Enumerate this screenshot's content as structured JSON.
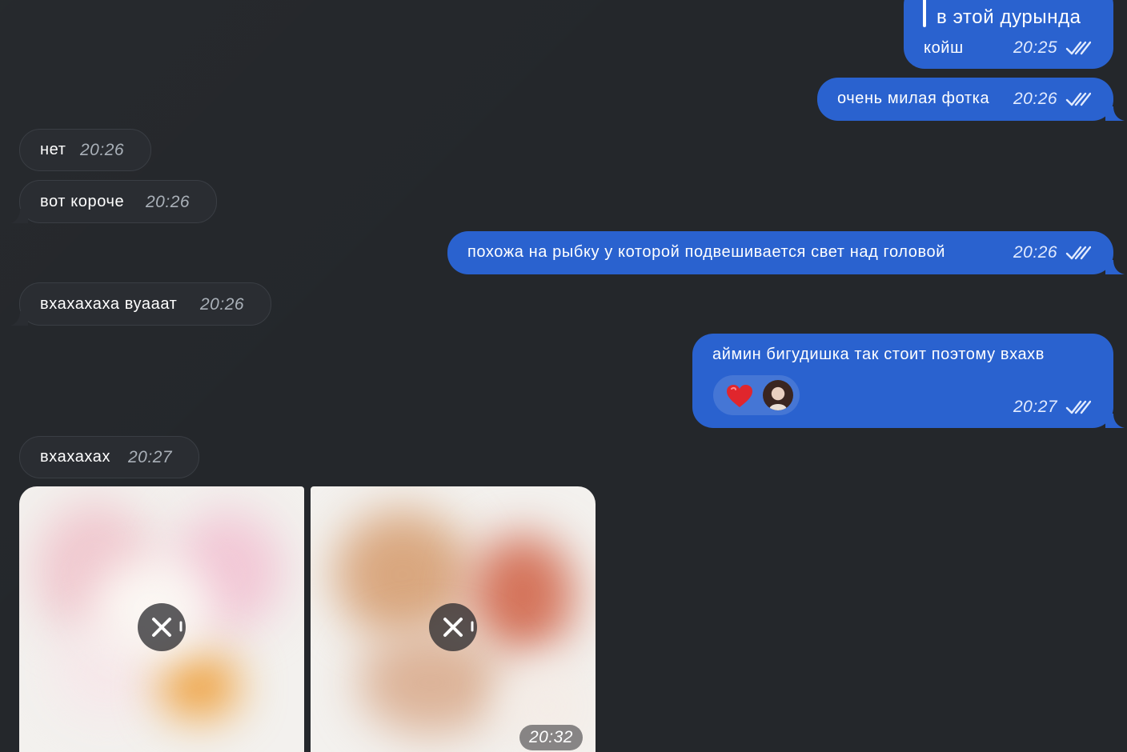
{
  "messages": [
    {
      "direction": "out",
      "reply_quote": "в этой дурында",
      "text": "койш",
      "time": "20:25",
      "status": "read"
    },
    {
      "direction": "out",
      "text": "очень милая фотка",
      "time": "20:26",
      "status": "read"
    },
    {
      "direction": "in",
      "text": "нет",
      "time": "20:26"
    },
    {
      "direction": "in",
      "text": "вот короче",
      "time": "20:26"
    },
    {
      "direction": "out",
      "text": "похожа на рыбку у которой подвешивается свет над головой",
      "time": "20:26",
      "status": "read"
    },
    {
      "direction": "in",
      "text": "вхахахаха вуааат",
      "time": "20:26"
    },
    {
      "direction": "out",
      "text": "аймин бигудишка так стоит поэтому вхахв",
      "time": "20:27",
      "status": "read",
      "reaction": {
        "emoji": "heart-icon",
        "by": "avatar"
      }
    },
    {
      "direction": "in",
      "text": "вхахахах",
      "time": "20:27"
    }
  ],
  "album": {
    "photos": [
      {
        "state": "uploading",
        "action_icon": "close-icon"
      },
      {
        "state": "uploading",
        "action_icon": "close-icon"
      }
    ],
    "time": "20:32"
  },
  "colors": {
    "background": "#24272b",
    "incoming_bubble": "#2a2d32",
    "outgoing_bubble": "#2a62cf",
    "reaction_heart": "#e0262d"
  }
}
